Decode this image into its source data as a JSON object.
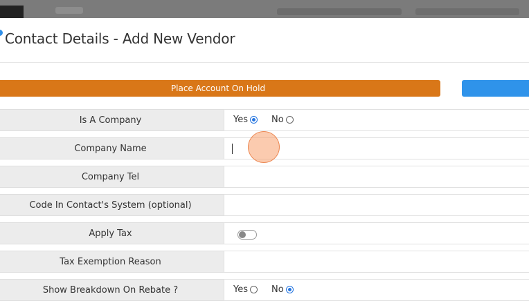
{
  "dialog": {
    "title": "Contact Details - Add New Vendor"
  },
  "actions": {
    "hold_label": "Place Account On Hold"
  },
  "form": {
    "is_company": {
      "label": "Is A Company",
      "yes": "Yes",
      "no": "No",
      "selected": "Yes"
    },
    "company_name": {
      "label": "Company Name",
      "value": ""
    },
    "company_tel": {
      "label": "Company Tel",
      "value": ""
    },
    "code": {
      "label": "Code In Contact's System (optional)",
      "value": ""
    },
    "apply_tax": {
      "label": "Apply Tax",
      "enabled": false
    },
    "tax_exemption": {
      "label": "Tax Exemption Reason",
      "value": ""
    },
    "show_breakdown": {
      "label": "Show Breakdown On Rebate ?",
      "yes": "Yes",
      "no": "No",
      "selected": "No"
    }
  },
  "colors": {
    "hold_button": "#d97718",
    "primary_button": "#2f93ea",
    "radio_selected": "#2575e0"
  }
}
